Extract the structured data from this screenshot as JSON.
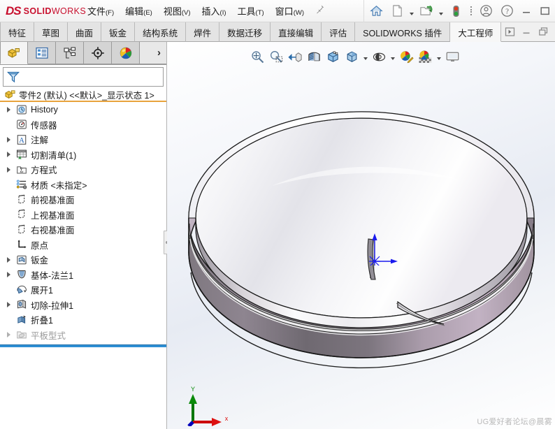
{
  "app": {
    "brand_mark": "DS",
    "brand_name": "SOLIDWORKS",
    "brand_name_bold": "SOLID",
    "brand_name_light": "WORKS",
    "brand_color": "#c8102e"
  },
  "menubar": {
    "items": [
      {
        "label": "文件",
        "mnemonic": "(F)",
        "name": "menu-file"
      },
      {
        "label": "编辑",
        "mnemonic": "(E)",
        "name": "menu-edit"
      },
      {
        "label": "视图",
        "mnemonic": "(V)",
        "name": "menu-view"
      },
      {
        "label": "插入",
        "mnemonic": "(I)",
        "name": "menu-insert"
      },
      {
        "label": "工具",
        "mnemonic": "(T)",
        "name": "menu-tools"
      },
      {
        "label": "窗口",
        "mnemonic": "(W)",
        "name": "menu-window"
      }
    ],
    "pin_icon": "pushpin-icon"
  },
  "titlebar_buttons": [
    {
      "icon": "home-icon",
      "label": ""
    },
    {
      "icon": "new-document-icon",
      "label": ""
    },
    {
      "icon": "open-folder-icon",
      "label": ""
    },
    {
      "icon": "traffic-light-icon",
      "label": ""
    },
    {
      "icon": "options-dots-icon",
      "label": ""
    },
    {
      "icon": "user-account-icon",
      "label": ""
    },
    {
      "icon": "help-question-icon",
      "label": ""
    }
  ],
  "window_controls": [
    {
      "icon": "minimize-icon",
      "label": ""
    },
    {
      "icon": "maximize-icon",
      "label": ""
    }
  ],
  "command_manager": {
    "tabs": [
      {
        "label": "特征",
        "active": false
      },
      {
        "label": "草图",
        "active": false
      },
      {
        "label": "曲面",
        "active": false
      },
      {
        "label": "钣金",
        "active": false
      },
      {
        "label": "结构系统",
        "active": false
      },
      {
        "label": "焊件",
        "active": false
      },
      {
        "label": "数据迁移",
        "active": false
      },
      {
        "label": "直接编辑",
        "active": false
      },
      {
        "label": "评估",
        "active": false
      },
      {
        "label": "SOLIDWORKS 插件",
        "active": false
      },
      {
        "label": "大工程师",
        "active": true
      }
    ],
    "right_icons": [
      {
        "icon": "panel-expand-icon"
      },
      {
        "icon": "doc-minimize-icon"
      },
      {
        "icon": "doc-restore-icon"
      }
    ]
  },
  "left_panel": {
    "tabs": [
      {
        "icon": "feature-tree-icon",
        "name": "tab-feature-manager",
        "active": true
      },
      {
        "icon": "property-manager-icon",
        "name": "tab-property-manager",
        "active": false
      },
      {
        "icon": "configuration-manager-icon",
        "name": "tab-configuration-manager",
        "active": false
      },
      {
        "icon": "dimxpert-icon",
        "name": "tab-dimxpert-manager",
        "active": false
      },
      {
        "icon": "appearances-sphere-icon",
        "name": "tab-display-manager",
        "active": false
      }
    ],
    "more_tabs_icon": "chevron-right-icon",
    "filter": {
      "icon": "filter-funnel-icon",
      "value": "",
      "placeholder": ""
    },
    "tree": {
      "root": {
        "icon": "part-document-icon",
        "label": "零件2 (默认) <<默认>_显示状态 1>"
      },
      "items": [
        {
          "label": "History",
          "icon": "history-icon",
          "expandable": true,
          "dim": false
        },
        {
          "label": "传感器",
          "icon": "sensor-icon",
          "expandable": false,
          "dim": false
        },
        {
          "label": "注解",
          "icon": "annotations-icon",
          "expandable": true,
          "dim": false
        },
        {
          "label": "切割清单(1)",
          "icon": "cutlist-icon",
          "expandable": true,
          "dim": false
        },
        {
          "label": "方程式",
          "icon": "equations-icon",
          "expandable": true,
          "dim": false
        },
        {
          "label": "材质 <未指定>",
          "icon": "material-icon",
          "expandable": false,
          "dim": false
        },
        {
          "label": "前视基准面",
          "icon": "plane-icon",
          "expandable": false,
          "dim": false
        },
        {
          "label": "上视基准面",
          "icon": "plane-icon",
          "expandable": false,
          "dim": false
        },
        {
          "label": "右视基准面",
          "icon": "plane-icon",
          "expandable": false,
          "dim": false
        },
        {
          "label": "原点",
          "icon": "origin-icon",
          "expandable": false,
          "dim": false
        },
        {
          "label": "钣金",
          "icon": "sheetmetal-icon",
          "expandable": true,
          "dim": false
        },
        {
          "label": "基体-法兰1",
          "icon": "base-flange-icon",
          "expandable": true,
          "dim": false
        },
        {
          "label": "展开1",
          "icon": "unfold-icon",
          "expandable": false,
          "dim": false
        },
        {
          "label": "切除-拉伸1",
          "icon": "extrude-cut-icon",
          "expandable": true,
          "dim": false
        },
        {
          "label": "折叠1",
          "icon": "fold-icon",
          "expandable": false,
          "dim": false
        },
        {
          "label": "平板型式",
          "icon": "flat-pattern-icon",
          "expandable": true,
          "dim": true
        }
      ],
      "rollback_bar_color": "#2e8fd4",
      "root_underline_color": "#e8a33d"
    }
  },
  "viewport": {
    "view_toolbar": [
      {
        "icon": "zoom-to-fit-icon",
        "has_caret": false
      },
      {
        "icon": "zoom-to-area-icon",
        "has_caret": false
      },
      {
        "icon": "previous-view-icon",
        "has_caret": false
      },
      {
        "icon": "section-view-icon",
        "has_caret": false
      },
      {
        "icon": "view-orientation-icon",
        "has_caret": false
      },
      {
        "icon": "display-style-icon",
        "has_caret": true
      },
      {
        "icon": "hide-show-items-icon",
        "has_caret": true
      },
      {
        "icon": "view-settings-icon",
        "has_caret": true
      },
      {
        "icon": "edit-appearance-icon",
        "has_caret": false
      },
      {
        "icon": "apply-scene-icon",
        "has_caret": true
      },
      {
        "icon": "view-display-icon",
        "has_caret": false
      }
    ],
    "origin_marker": {
      "name": "model-origin-triad",
      "color": "#1a1aee"
    },
    "axis_triad": {
      "name": "reference-triad",
      "x_label": "x",
      "y_label": "Y",
      "z_label": "",
      "x_color": "#cc0000",
      "y_color": "#007700",
      "z_color": "#0000bb"
    },
    "watermark": "UG爱好者论坛@晨雾",
    "model": {
      "name": "sheet-metal-ring",
      "description": "圆形钣金环",
      "surface_color_light": "#cfc3d0",
      "surface_color_mid": "#9e8fa1",
      "surface_color_dark": "#6f6870",
      "edge_color": "#1a1a1a"
    }
  }
}
